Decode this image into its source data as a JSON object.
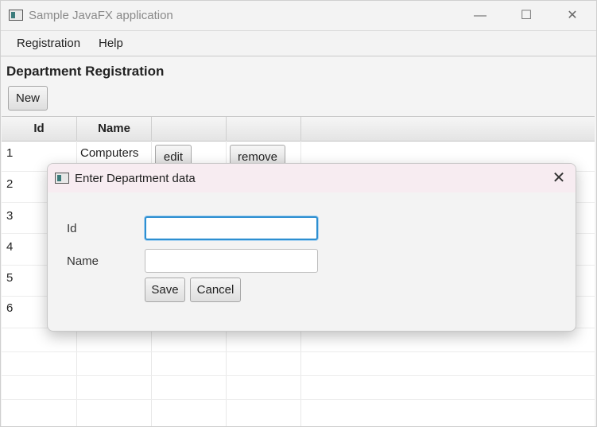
{
  "window": {
    "title": "Sample JavaFX application",
    "controls": {
      "minimize": "—",
      "maximize": "☐",
      "close": "✕"
    }
  },
  "menu": {
    "items": [
      "Registration",
      "Help"
    ]
  },
  "page": {
    "heading": "Department Registration",
    "new_label": "New"
  },
  "table": {
    "columns": [
      "Id",
      "Name",
      "",
      "",
      ""
    ],
    "rows": [
      {
        "id": "1",
        "name": "Computers",
        "edit": "edit",
        "remove": "remove"
      },
      {
        "id": "2"
      },
      {
        "id": "3"
      },
      {
        "id": "4"
      },
      {
        "id": "5"
      },
      {
        "id": "6"
      }
    ]
  },
  "dialog": {
    "title": "Enter Department data",
    "close": "✕",
    "id_label": "Id",
    "id_value": "",
    "name_label": "Name",
    "name_value": "",
    "save_label": "Save",
    "cancel_label": "Cancel"
  },
  "colors": {
    "focus": "#2d8fd1",
    "dialog_title_bg": "#f7ecf1"
  }
}
